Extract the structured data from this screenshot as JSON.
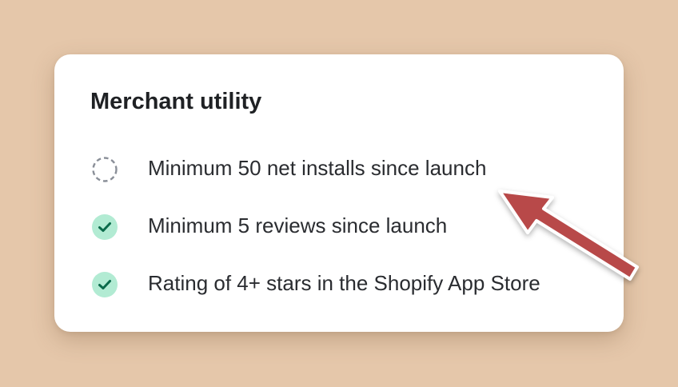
{
  "card": {
    "title": "Merchant utility",
    "items": [
      {
        "label": "Minimum 50 net installs since launch",
        "status": "incomplete",
        "icon": "dashed-circle-icon"
      },
      {
        "label": "Minimum 5 reviews since launch",
        "status": "complete",
        "icon": "check-circle-icon"
      },
      {
        "label": "Rating of 4+ stars in the Shopify App Store",
        "status": "complete",
        "icon": "check-circle-icon"
      }
    ]
  },
  "annotation": {
    "icon": "arrow-icon",
    "color": "#b84a4a"
  },
  "colors": {
    "background": "#e5c7aa",
    "card": "#ffffff",
    "check_fill": "#b2ebd3",
    "check_mark": "#0b6b4b",
    "pending_ring": "#8a8f98"
  }
}
